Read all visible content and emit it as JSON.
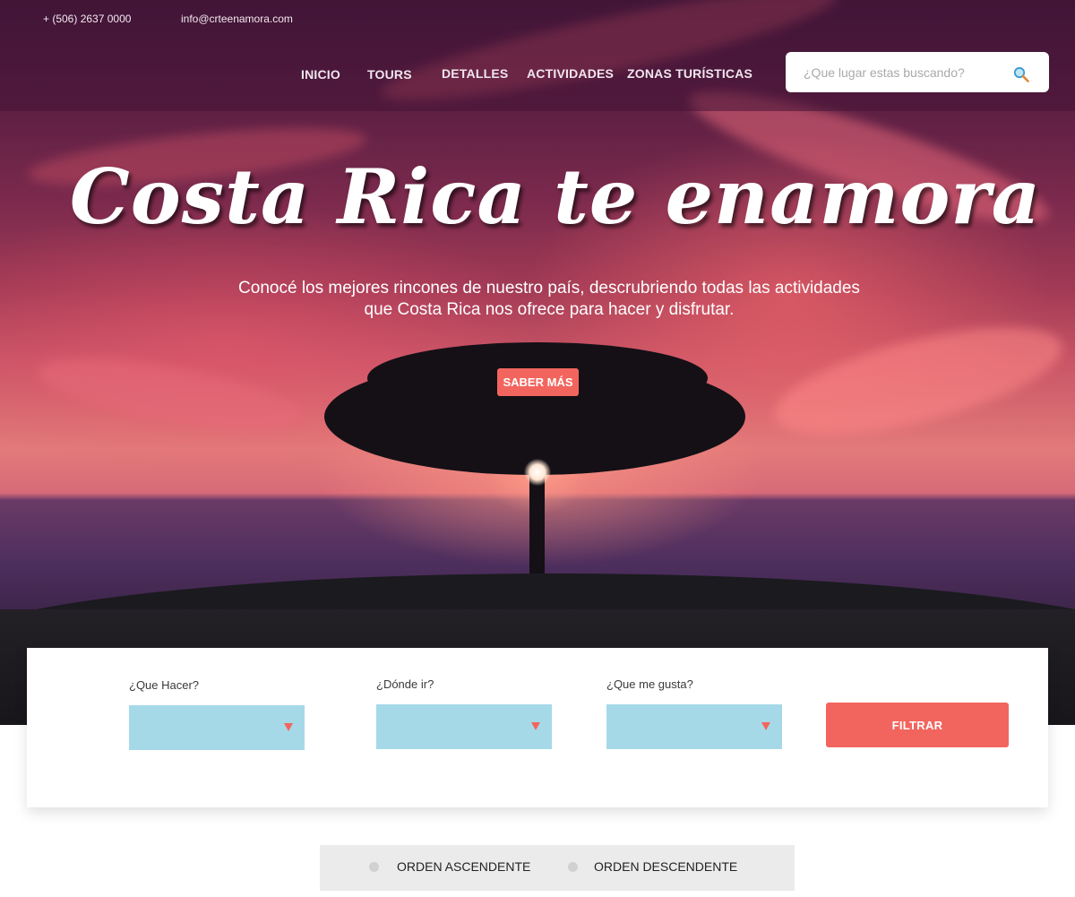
{
  "header": {
    "phone": "+ (506) 2637 0000",
    "email": "info@crteenamora.com",
    "nav": [
      "INICIO",
      "TOURS",
      "DETALLES",
      "ACTIVIDADES",
      "ZONAS TURÍSTICAS"
    ],
    "search": {
      "placeholder": "¿Que lugar estas buscando?",
      "icon": "search-icon"
    }
  },
  "hero": {
    "title": "Costa Rica te enamora",
    "subtitle": "Conocé los mejores rincones de nuestro país, descrubriendo todas las actividades que Costa Rica nos ofrece para hacer y disfrutar.",
    "cta": "SABER MÁS"
  },
  "filters": {
    "fields": [
      {
        "label": "¿Que Hacer?",
        "value": ""
      },
      {
        "label": "¿Dónde ir?",
        "value": ""
      },
      {
        "label": "¿Que me gusta?",
        "value": ""
      }
    ],
    "submit": "FILTRAR"
  },
  "sort": {
    "options": [
      "ORDEN ASCENDENTE",
      "ORDEN DESCENDENTE"
    ]
  },
  "colors": {
    "accent": "#f2655e",
    "select_bg": "#a6d9e8",
    "sort_bg": "#ebebeb",
    "topbar_overlay": "#461437"
  }
}
